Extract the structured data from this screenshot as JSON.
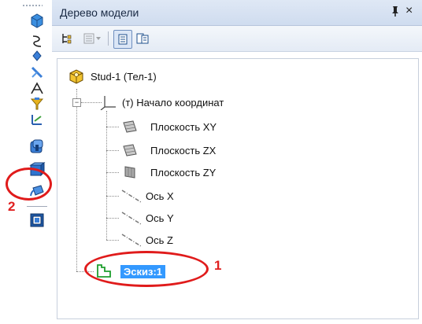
{
  "panel": {
    "title": "Дерево модели",
    "pin_glyph": "ꟼ",
    "close_glyph": "×"
  },
  "tree": {
    "root": "Stud-1 (Тел-1)",
    "origin": "(т) Начало координат",
    "items": [
      {
        "label": "Плоскость XY",
        "icon": "plane-icon"
      },
      {
        "label": "Плоскость ZX",
        "icon": "plane-icon"
      },
      {
        "label": "Плоскость ZY",
        "icon": "plane-icon"
      },
      {
        "label": "Ось X",
        "icon": "axis-icon"
      },
      {
        "label": "Ось Y",
        "icon": "axis-icon"
      },
      {
        "label": "Ось Z",
        "icon": "axis-icon"
      }
    ],
    "sketch": "Эскиз:1"
  },
  "annotations": {
    "one": "1",
    "two": "2"
  },
  "left_toolbar": {
    "icons": [
      "orient-icon",
      "curve-icon",
      "point-icon",
      "line-icon",
      "polyline-icon",
      "filter-icon",
      "measure-icon",
      "extrude-icon",
      "boolean-icon",
      "rotate-icon",
      "frame-icon"
    ]
  },
  "colors": {
    "selection": "#3399ff",
    "annotation_red": "#e01b1b",
    "titlebar": "#d6e1f1"
  }
}
